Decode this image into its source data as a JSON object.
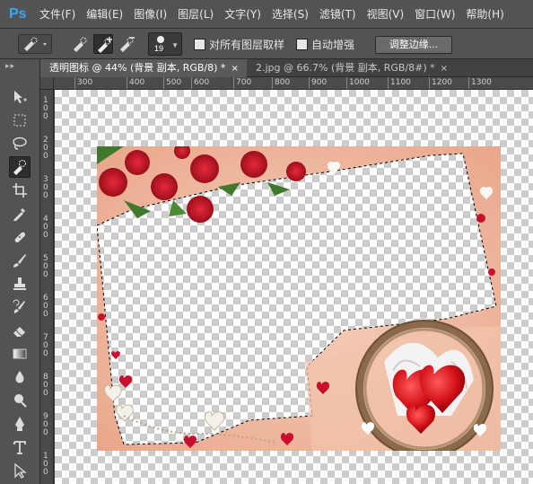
{
  "app": {
    "logo": "Ps"
  },
  "menu": [
    "文件(F)",
    "编辑(E)",
    "图像(I)",
    "图层(L)",
    "文字(Y)",
    "选择(S)",
    "滤镜(T)",
    "视图(V)",
    "窗口(W)",
    "帮助(H)"
  ],
  "options": {
    "brush_size": "19",
    "sample_all_layers_label": "对所有图层取样",
    "auto_enhance_label": "自动增强",
    "refine_edge_label": "调整边缘..."
  },
  "tabs": [
    {
      "label": "透明图标 @ 44% (背景 副本, RGB/8) *",
      "close": "×"
    },
    {
      "label": "2.jpg @ 66.7% (背景 副本, RGB/8#) *",
      "close": "×"
    }
  ],
  "ruler_top": [
    "300",
    "400",
    "500",
    "600",
    "700",
    "800",
    "900",
    "1000",
    "1100",
    "1200",
    "1300"
  ],
  "ruler_left": [
    "100",
    "200",
    "300",
    "400",
    "500",
    "600",
    "700",
    "800",
    "900",
    "100"
  ],
  "colors": {
    "accent": "#31a8ff",
    "ui_dark": "#535353",
    "rose_red": "#c8102e",
    "peach_bg": "#efbaa0"
  },
  "tools": [
    "move-icon",
    "marquee-icon",
    "lasso-icon",
    "quick-selection-icon",
    "crop-icon",
    "eyedropper-icon",
    "healing-brush-icon",
    "brush-icon",
    "clone-stamp-icon",
    "history-brush-icon",
    "eraser-icon",
    "gradient-icon",
    "blur-icon",
    "dodge-icon",
    "pen-icon",
    "type-icon",
    "path-selection-icon"
  ]
}
